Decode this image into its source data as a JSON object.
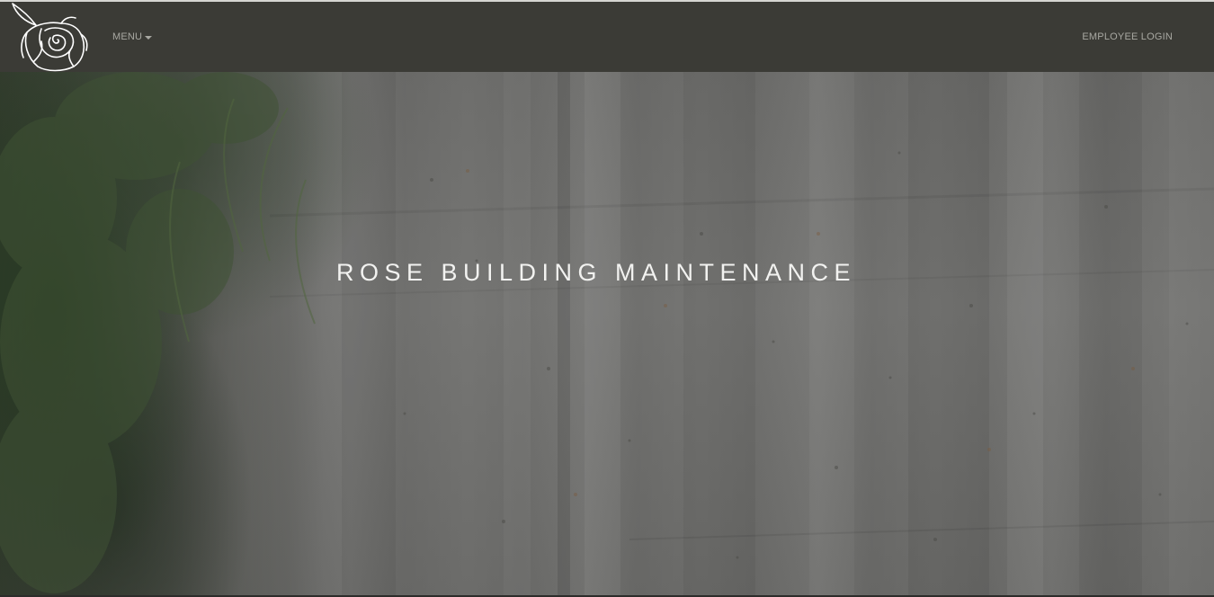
{
  "navbar": {
    "logo_icon": "rose-logo-icon",
    "menu_label": "MENU",
    "menu_caret_icon": "caret-down-icon",
    "employee_login_label": "EMPLOYEE LOGIN"
  },
  "hero": {
    "title": "ROSE BUILDING MAINTENANCE",
    "background": "concrete-wall-with-foliage"
  },
  "colors": {
    "navbar_bg": "#3b3b36",
    "nav_text": "#a8a8a2",
    "hero_title": "#f2f2f0"
  }
}
